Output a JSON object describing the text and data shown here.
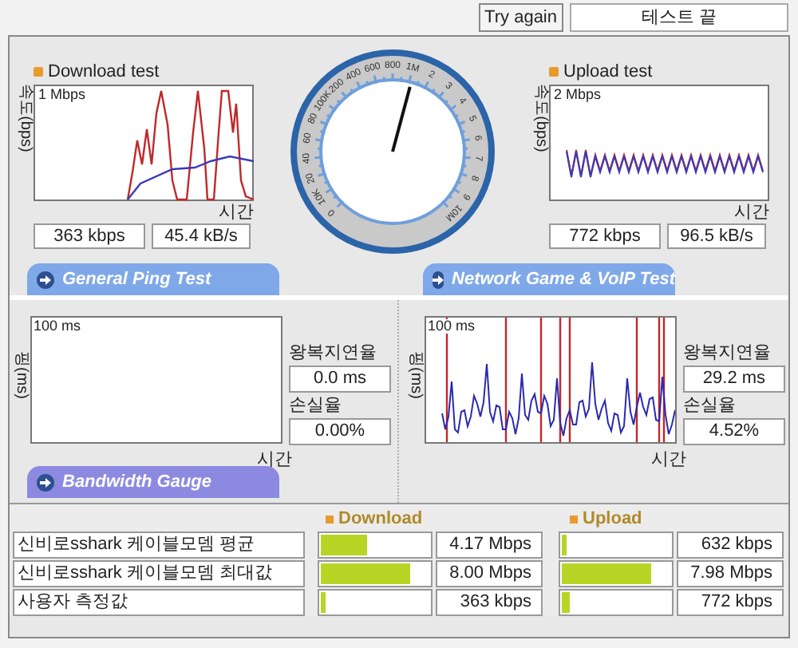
{
  "top_bar": {
    "button": "Try again",
    "status": "테스트 끝"
  },
  "speed_tests": [
    {
      "title": "Download test",
      "axis_label": "속도(bps)",
      "scale": "1 Mbps",
      "time_label": "시간",
      "readings": [
        "363 kbps",
        "45.4 kB/s"
      ]
    },
    {
      "title": "Upload test",
      "axis_label": "속도(bps)",
      "scale": "2 Mbps",
      "time_label": "시간",
      "readings": [
        "772 kbps",
        "96.5 kB/s"
      ]
    }
  ],
  "gauge": {
    "scale_labels": [
      "0",
      "10K",
      "20",
      "40",
      "60",
      "80",
      "100K",
      "200",
      "400",
      "600",
      "800",
      "1M",
      "2",
      "3",
      "4",
      "5",
      "6",
      "7",
      "8",
      "9",
      "10M"
    ]
  },
  "section_tabs": [
    {
      "title": "General Ping Test"
    },
    {
      "title": "Network Game & VoIP Test"
    }
  ],
  "ping_tests": [
    {
      "axis_label": "핑(ms)",
      "scale": "100 ms",
      "time_label": "시간",
      "trace": false,
      "rtt_label": "왕복지연율",
      "rtt": "0.0 ms",
      "loss_label": "손실율",
      "loss": "0.00%"
    },
    {
      "axis_label": "핑(ms)",
      "scale": "100 ms",
      "time_label": "시간",
      "trace": true,
      "rtt_label": "왕복지연율",
      "rtt": "29.2 ms",
      "loss_label": "손실율",
      "loss": "4.52%"
    }
  ],
  "bandwidth": {
    "title": "Bandwidth Gauge",
    "columns": [
      "Download",
      "Upload"
    ],
    "rows": [
      {
        "label": "신비로sshark 케이블모뎀 평균",
        "download": {
          "level": 0.42,
          "value": "4.17 Mbps"
        },
        "upload": {
          "level": 0.05,
          "value": "632 kbps"
        }
      },
      {
        "label": "신비로sshark 케이블모뎀 최대값",
        "download": {
          "level": 0.82,
          "value": "8.00 Mbps"
        },
        "upload": {
          "level": 0.82,
          "value": "7.98 Mbps"
        }
      },
      {
        "label": "사용자 측정값",
        "download": {
          "level": 0.04,
          "value": "363 kbps"
        },
        "upload": {
          "level": 0.08,
          "value": "772 kbps"
        }
      }
    ]
  }
}
